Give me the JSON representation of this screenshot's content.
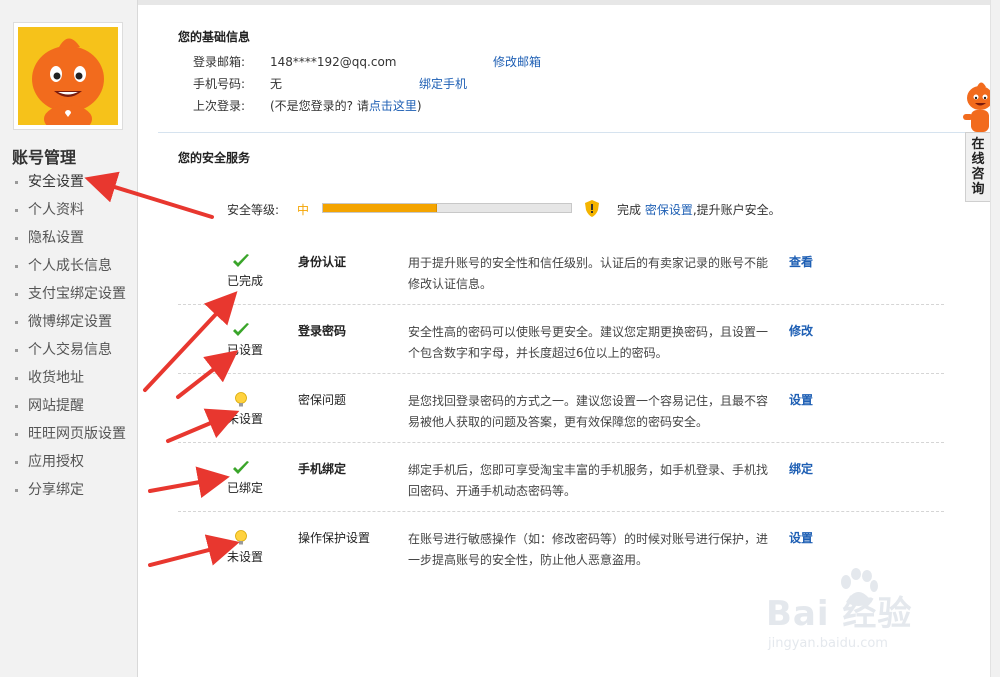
{
  "sidebar": {
    "title": "账号管理",
    "items": [
      {
        "label": "安全设置",
        "active": true
      },
      {
        "label": "个人资料"
      },
      {
        "label": "隐私设置"
      },
      {
        "label": "个人成长信息"
      },
      {
        "label": "支付宝绑定设置"
      },
      {
        "label": "微博绑定设置"
      },
      {
        "label": "个人交易信息"
      },
      {
        "label": "收货地址"
      },
      {
        "label": "网站提醒"
      },
      {
        "label": "旺旺网页版设置"
      },
      {
        "label": "应用授权"
      },
      {
        "label": "分享绑定"
      }
    ]
  },
  "basic_info": {
    "title": "您的基础信息",
    "email_label": "登录邮箱:",
    "email_value": "148****192@qq.com",
    "email_action": "修改邮箱",
    "phone_label": "手机号码:",
    "phone_value": "无",
    "phone_action": "绑定手机",
    "last_login_label": "上次登录:",
    "last_login_text": "(不是您登录的? 请",
    "last_login_link": "点击这里",
    "last_login_suffix": ")"
  },
  "security": {
    "title": "您的安全服务",
    "level_label": "安全等级:",
    "level_value": "中",
    "level_fraction": 0.46,
    "hint_prefix": "完成",
    "hint_link": "密保设置",
    "hint_suffix": ",提升账户安全。",
    "colors": {
      "accent": "#f4a400",
      "link": "#1e5fb4",
      "check": "#3aa52a"
    },
    "services": [
      {
        "icon": "check-icon",
        "status": "已完成",
        "name": "身份认证",
        "desc": "用于提升账号的安全性和信任级别。认证后的有卖家记录的账号不能修改认证信息。",
        "action": "查看"
      },
      {
        "icon": "check-icon",
        "status": "已设置",
        "name": "登录密码",
        "desc": "安全性高的密码可以使账号更安全。建议您定期更换密码，且设置一个包含数字和字母，并长度超过6位以上的密码。",
        "action": "修改"
      },
      {
        "icon": "bulb-icon",
        "status": "未设置",
        "name": "密保问题",
        "desc": "是您找回登录密码的方式之一。建议您设置一个容易记住，且最不容易被他人获取的问题及答案，更有效保障您的密码安全。",
        "action": "设置"
      },
      {
        "icon": "check-icon",
        "status": "已绑定",
        "name": "手机绑定",
        "desc": "绑定手机后，您即可享受淘宝丰富的手机服务，如手机登录、手机找回密码、开通手机动态密码等。",
        "action": "绑定"
      },
      {
        "icon": "bulb-icon",
        "status": "未设置",
        "name": "操作保护设置",
        "desc": "在账号进行敏感操作（如：修改密码等）的时候对账号进行保护，进一步提高账号的安全性，防止他人恶意盗用。",
        "action": "设置"
      }
    ]
  },
  "consult": {
    "label": "在线咨询"
  },
  "watermark": {
    "brand": "Bai 经验",
    "url": "jingyan.baidu.com"
  }
}
